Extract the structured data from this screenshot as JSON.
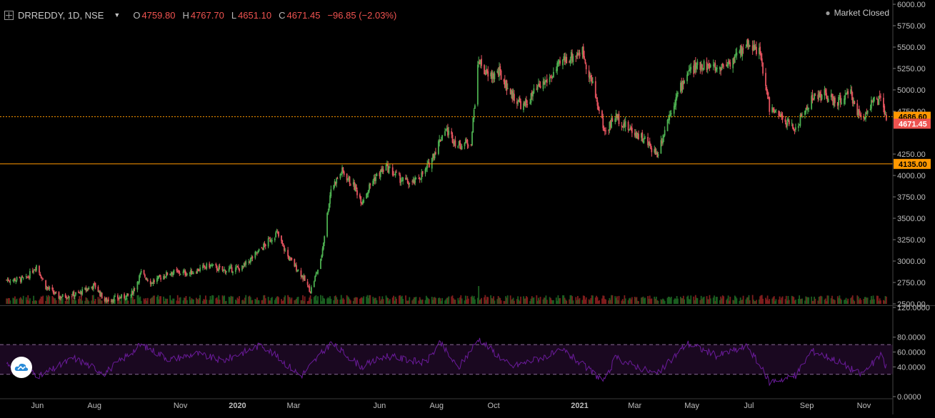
{
  "header": {
    "symbol": "DRREDDY, 1D, NSE",
    "open_label": "O",
    "open": "4759.80",
    "high_label": "H",
    "high": "4767.70",
    "low_label": "L",
    "low": "4651.10",
    "close_label": "C",
    "close": "4671.45",
    "change": "−96.85 (−2.03%)",
    "market_status": "Market Closed"
  },
  "colors": {
    "up": "#26a69a",
    "down": "#ef5350",
    "up_candle": "#4caf50",
    "down_candle": "#e5535f",
    "hline": "#ff9800",
    "rsi": "#6a1b9a",
    "background": "#000000"
  },
  "icons": {
    "symbol_icon": "plus-square-icon",
    "dropdown": "caret-down-icon",
    "logo": "cloud-logo-icon"
  },
  "chart_data": [
    {
      "type": "candlestick",
      "title": "DRREDDY, 1D, NSE",
      "ylim": [
        2500,
        6000
      ],
      "y_ticks": [
        "6000.00",
        "5750.00",
        "5500.00",
        "5250.00",
        "5000.00",
        "4750.00",
        "4250.00",
        "4000.00",
        "3750.00",
        "3500.00",
        "3250.00",
        "3000.00",
        "2750.00",
        "2500.00"
      ],
      "x_ticks": [
        "Jun",
        "Aug",
        "Nov",
        "2020",
        "Mar",
        "Jun",
        "Aug",
        "Oct",
        "2021",
        "Mar",
        "May",
        "Jul",
        "Sep",
        "Nov"
      ],
      "horizontal_lines": [
        {
          "value": 4686.6,
          "label": "4686.60",
          "style": "dotted"
        },
        {
          "value": 4135.0,
          "label": "4135.00",
          "style": "solid"
        }
      ],
      "last_price": {
        "value": 4671.45,
        "label": "4671.45"
      },
      "close_series_anchors": [
        [
          "2019-04-29",
          2780
        ],
        [
          "2019-05-20",
          2790
        ],
        [
          "2019-05-31",
          2950
        ],
        [
          "2019-06-10",
          2700
        ],
        [
          "2019-06-24",
          2580
        ],
        [
          "2019-07-15",
          2620
        ],
        [
          "2019-08-01",
          2720
        ],
        [
          "2019-08-12",
          2540
        ],
        [
          "2019-08-26",
          2570
        ],
        [
          "2019-09-09",
          2600
        ],
        [
          "2019-09-20",
          2860
        ],
        [
          "2019-10-01",
          2750
        ],
        [
          "2019-10-21",
          2870
        ],
        [
          "2019-11-11",
          2860
        ],
        [
          "2019-12-02",
          2950
        ],
        [
          "2019-12-16",
          2890
        ],
        [
          "2020-01-06",
          2920
        ],
        [
          "2020-01-27",
          3150
        ],
        [
          "2020-02-12",
          3330
        ],
        [
          "2020-02-24",
          3050
        ],
        [
          "2020-03-09",
          2850
        ],
        [
          "2020-03-19",
          2650
        ],
        [
          "2020-03-30",
          3000
        ],
        [
          "2020-04-10",
          3850
        ],
        [
          "2020-04-22",
          4050
        ],
        [
          "2020-05-06",
          3850
        ],
        [
          "2020-05-13",
          3700
        ],
        [
          "2020-05-25",
          3950
        ],
        [
          "2020-06-08",
          4100
        ],
        [
          "2020-06-24",
          3950
        ],
        [
          "2020-07-06",
          3900
        ],
        [
          "2020-07-20",
          4050
        ],
        [
          "2020-07-31",
          4300
        ],
        [
          "2020-08-10",
          4550
        ],
        [
          "2020-08-24",
          4350
        ],
        [
          "2020-09-07",
          4400
        ],
        [
          "2020-09-15",
          5350
        ],
        [
          "2020-09-25",
          5150
        ],
        [
          "2020-10-07",
          5200
        ],
        [
          "2020-10-20",
          4950
        ],
        [
          "2020-11-02",
          4800
        ],
        [
          "2020-11-16",
          5000
        ],
        [
          "2020-12-01",
          5150
        ],
        [
          "2020-12-15",
          5350
        ],
        [
          "2021-01-04",
          5450
        ],
        [
          "2021-01-15",
          5050
        ],
        [
          "2021-01-28",
          4500
        ],
        [
          "2021-02-08",
          4700
        ],
        [
          "2021-02-22",
          4550
        ],
        [
          "2021-03-08",
          4450
        ],
        [
          "2021-03-25",
          4250
        ],
        [
          "2021-04-08",
          4750
        ],
        [
          "2021-04-26",
          5200
        ],
        [
          "2021-05-12",
          5300
        ],
        [
          "2021-05-28",
          5250
        ],
        [
          "2021-06-14",
          5350
        ],
        [
          "2021-06-30",
          5550
        ],
        [
          "2021-07-12",
          5450
        ],
        [
          "2021-07-23",
          4800
        ],
        [
          "2021-08-06",
          4650
        ],
        [
          "2021-08-20",
          4550
        ],
        [
          "2021-09-06",
          4900
        ],
        [
          "2021-09-20",
          4950
        ],
        [
          "2021-10-01",
          4850
        ],
        [
          "2021-10-18",
          4950
        ],
        [
          "2021-10-29",
          4650
        ],
        [
          "2021-11-09",
          4850
        ],
        [
          "2021-11-19",
          4880
        ],
        [
          "2021-11-25",
          4671
        ]
      ],
      "volume_spikes": [
        [
          "2020-09-15",
          4.0
        ],
        [
          "2020-04-06",
          1.2
        ],
        [
          "2020-08-03",
          1.3
        ],
        [
          "2021-07-23",
          1.1
        ]
      ]
    },
    {
      "type": "line",
      "title": "RSI",
      "ylim": [
        0,
        120
      ],
      "y_ticks": [
        "120.0000",
        "80.0000",
        "60.0000",
        "40.0000",
        "0.0000"
      ],
      "bands": [
        70,
        30
      ],
      "series_anchors": [
        [
          "2019-04-29",
          45
        ],
        [
          "2019-06-05",
          28
        ],
        [
          "2019-07-10",
          52
        ],
        [
          "2019-08-12",
          32
        ],
        [
          "2019-09-20",
          70
        ],
        [
          "2019-10-21",
          50
        ],
        [
          "2019-11-18",
          58
        ],
        [
          "2019-12-16",
          48
        ],
        [
          "2020-01-27",
          70
        ],
        [
          "2020-03-09",
          28
        ],
        [
          "2020-04-10",
          72
        ],
        [
          "2020-05-13",
          40
        ],
        [
          "2020-06-08",
          55
        ],
        [
          "2020-07-20",
          45
        ],
        [
          "2020-08-05",
          72
        ],
        [
          "2020-08-24",
          38
        ],
        [
          "2020-09-15",
          78
        ],
        [
          "2020-10-20",
          40
        ],
        [
          "2020-12-15",
          62
        ],
        [
          "2021-01-28",
          20
        ],
        [
          "2021-02-08",
          52
        ],
        [
          "2021-03-25",
          30
        ],
        [
          "2021-04-26",
          72
        ],
        [
          "2021-05-28",
          55
        ],
        [
          "2021-06-30",
          68
        ],
        [
          "2021-07-23",
          20
        ],
        [
          "2021-08-20",
          28
        ],
        [
          "2021-09-06",
          62
        ],
        [
          "2021-10-01",
          50
        ],
        [
          "2021-10-29",
          30
        ],
        [
          "2021-11-19",
          55
        ],
        [
          "2021-11-25",
          40
        ]
      ]
    }
  ]
}
